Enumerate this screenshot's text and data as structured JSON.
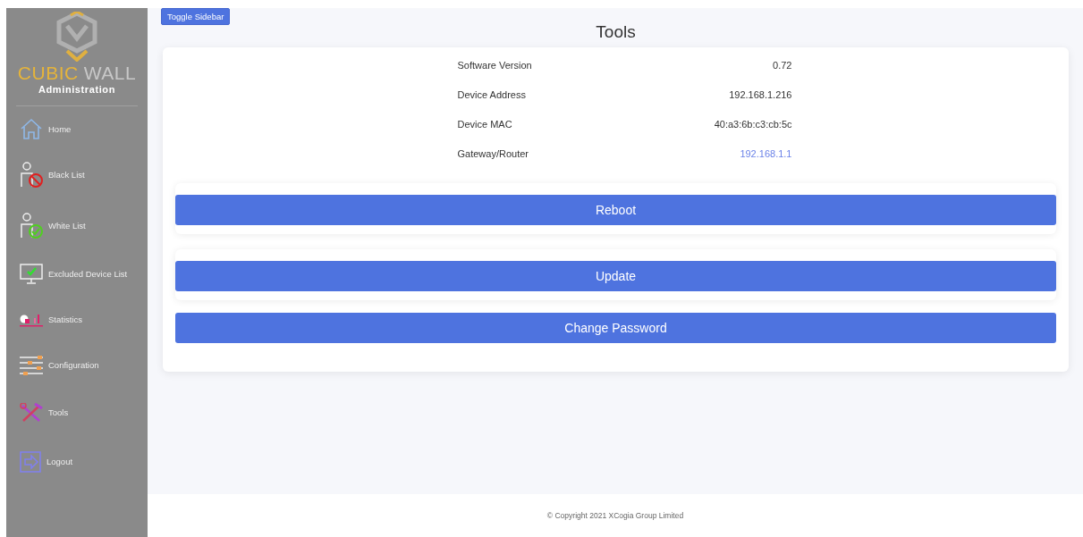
{
  "sidebar": {
    "logo": {
      "part_1": "CUBIC",
      "part_2": "WALL"
    },
    "subtitle": "Administration",
    "items": [
      {
        "label": "Home"
      },
      {
        "label": "Black List"
      },
      {
        "label": "White List"
      },
      {
        "label": "Excluded Device List"
      },
      {
        "label": "Statistics"
      },
      {
        "label": "Configuration"
      },
      {
        "label": "Tools"
      },
      {
        "label": "Logout"
      }
    ]
  },
  "toggle_button": "Toggle Sidebar",
  "title": "Tools",
  "info": [
    {
      "label": "Software Version",
      "value": "0.72",
      "kind": "text"
    },
    {
      "label": "Device Address",
      "value": "192.168.1.216",
      "kind": "text"
    },
    {
      "label": "Device MAC",
      "value": "40:a3:6b:c3:cb:5c",
      "kind": "text"
    },
    {
      "label": "Gateway/Router",
      "value": "192.168.1.1",
      "kind": "link"
    }
  ],
  "actions": [
    {
      "label": "Reboot",
      "framed": true
    },
    {
      "label": "Update",
      "framed": true
    },
    {
      "label": "Change Password",
      "framed": false
    }
  ],
  "footer": "© Copyright 2021 XCogia Group Limited"
}
